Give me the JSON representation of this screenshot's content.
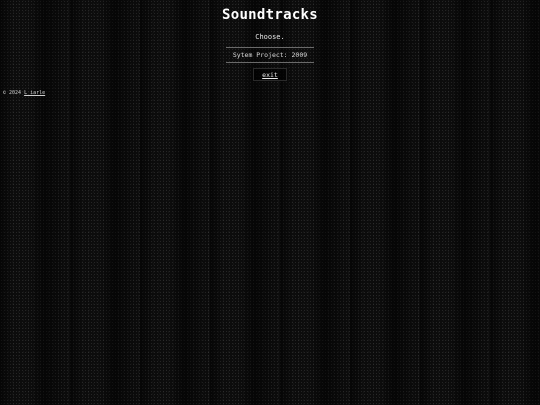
{
  "page": {
    "title": "Soundtracks",
    "prompt": "Choose.",
    "tracks": [
      {
        "label": "Sytem Project: 2009"
      }
    ],
    "exit_label": "exit",
    "copyright_prefix": "© 2024",
    "copyright_author": "L_iarle"
  },
  "colors": {
    "background": "#0c0c0c",
    "text": "#e8e8e8",
    "divider": "#6a6a6a"
  }
}
